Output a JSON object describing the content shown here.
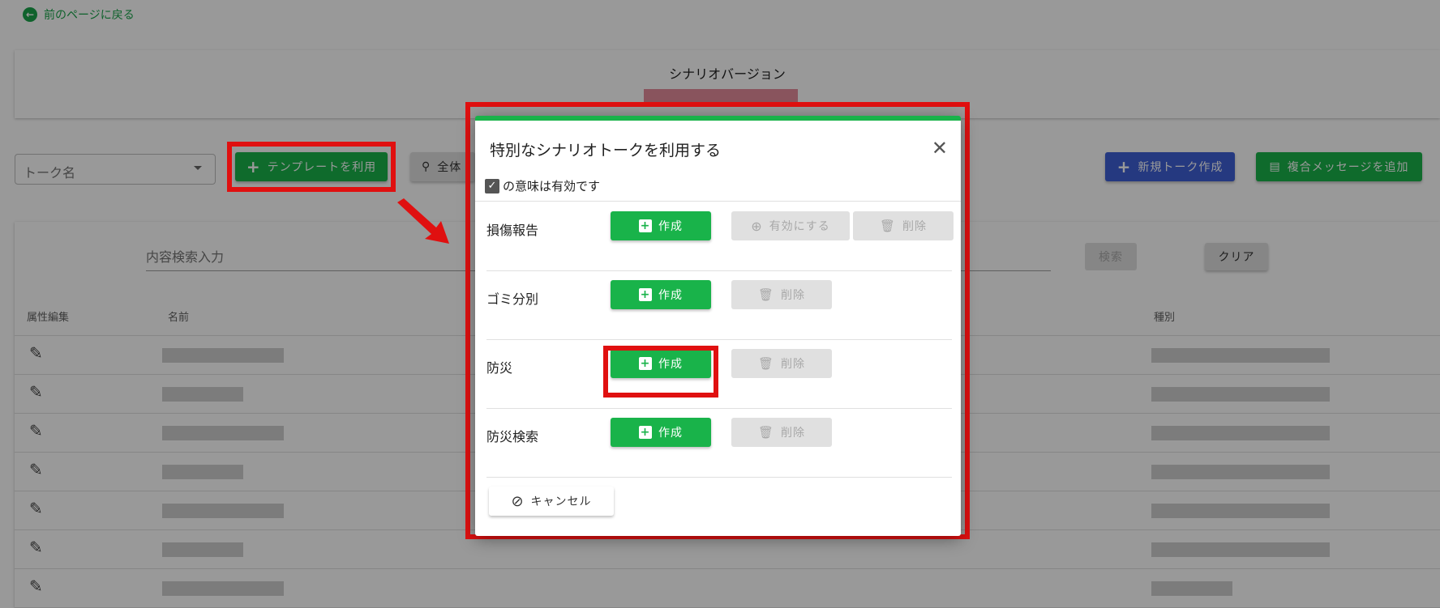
{
  "back_link": "前のページに戻る",
  "version": {
    "label": "シナリオバージョン"
  },
  "toolbar": {
    "talk_select_label": "トーク名",
    "use_template": "テンプレートを利用",
    "overview": "全体",
    "new_talk": "新規トーク作成",
    "add_composite": "複合メッセージを追加"
  },
  "search": {
    "placeholder": "内容検索入力",
    "search_btn": "検索",
    "clear_btn": "クリア"
  },
  "table": {
    "col_attr_edit": "属性編集",
    "col_name": "名前",
    "col_kind": "種別",
    "row_count": 7
  },
  "modal": {
    "title": "特別なシナリオトークを利用する",
    "note": "の意味は有効です",
    "create_label": "作成",
    "enable_label": "有効にする",
    "delete_label": "削除",
    "cancel_label": "キャンセル",
    "templates": [
      {
        "name": "損傷報告"
      },
      {
        "name": "ゴミ分別"
      },
      {
        "name": "防災"
      },
      {
        "name": "防災検索"
      }
    ]
  },
  "colors": {
    "brand_green": "#19b34a",
    "primary_blue": "#3f5fd6",
    "highlight_red": "#e01010"
  }
}
